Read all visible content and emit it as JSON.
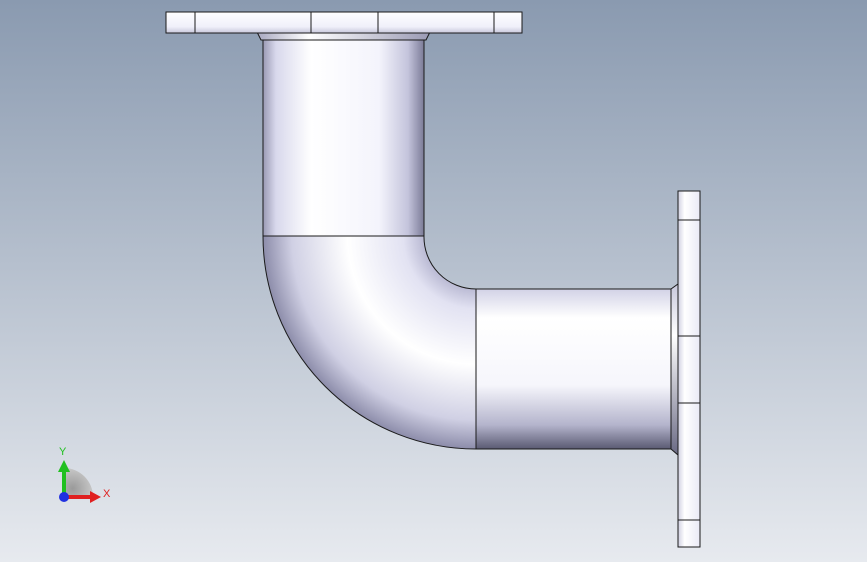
{
  "viewport": {
    "background_top": "#8a9ab0",
    "background_bottom": "#e7eaef"
  },
  "triad": {
    "x_label": "X",
    "y_label": "Y",
    "x_color": "#e02020",
    "y_color": "#20c020",
    "z_color": "#2030e0"
  },
  "model": {
    "part": "pipe-elbow-with-flanges",
    "edge_color": "#1a1a1a",
    "face_light": "#ffffff",
    "face_mid": "#d6d6ea",
    "face_dark": "#8a8aa6"
  }
}
